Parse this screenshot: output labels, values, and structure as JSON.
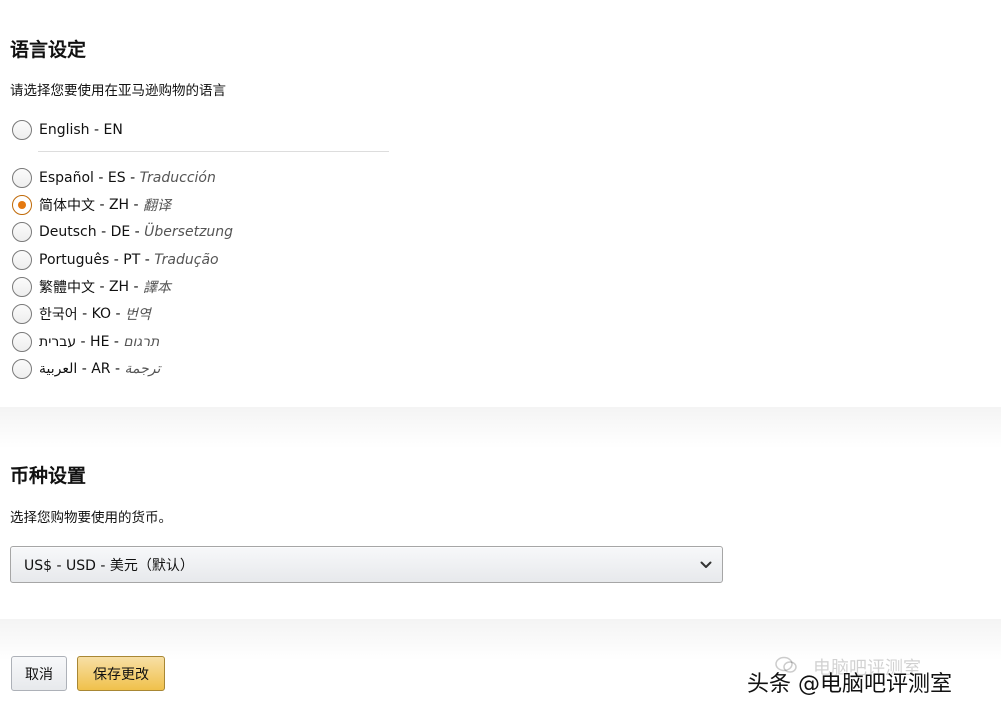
{
  "language": {
    "title": "语言设定",
    "description": "请选择您要使用在亚马逊购物的语言",
    "options": [
      {
        "name": "English",
        "code": "EN",
        "translation": ""
      },
      {
        "name": "Español",
        "code": "ES",
        "translation": "Traducción"
      },
      {
        "name": "简体中文",
        "code": "ZH",
        "translation": "翻译"
      },
      {
        "name": "Deutsch",
        "code": "DE",
        "translation": "Übersetzung"
      },
      {
        "name": "Português",
        "code": "PT",
        "translation": "Tradução"
      },
      {
        "name": "繁體中文",
        "code": "ZH",
        "translation": "譯本"
      },
      {
        "name": "한국어",
        "code": "KO",
        "translation": "번역"
      },
      {
        "name": "עברית",
        "code": "HE",
        "translation": "תרגום"
      },
      {
        "name": "العربية",
        "code": "AR",
        "translation": "ترجمة"
      }
    ],
    "selected_index": 2
  },
  "currency": {
    "title": "币种设置",
    "description": "选择您购物要使用的货币。",
    "selected": "US$ - USD - 美元（默认）"
  },
  "buttons": {
    "cancel": "取消",
    "save": "保存更改"
  },
  "watermark": {
    "primary": "头条 @电脑吧评测室",
    "secondary": "电脑吧评测室"
  },
  "icons": {
    "select_arrow": "chevron-down-icon",
    "watermark_logo": "wechat-icon"
  },
  "colors": {
    "radio_selected": "#e47911",
    "save_button": "#f0c14b",
    "text": "#111111"
  }
}
